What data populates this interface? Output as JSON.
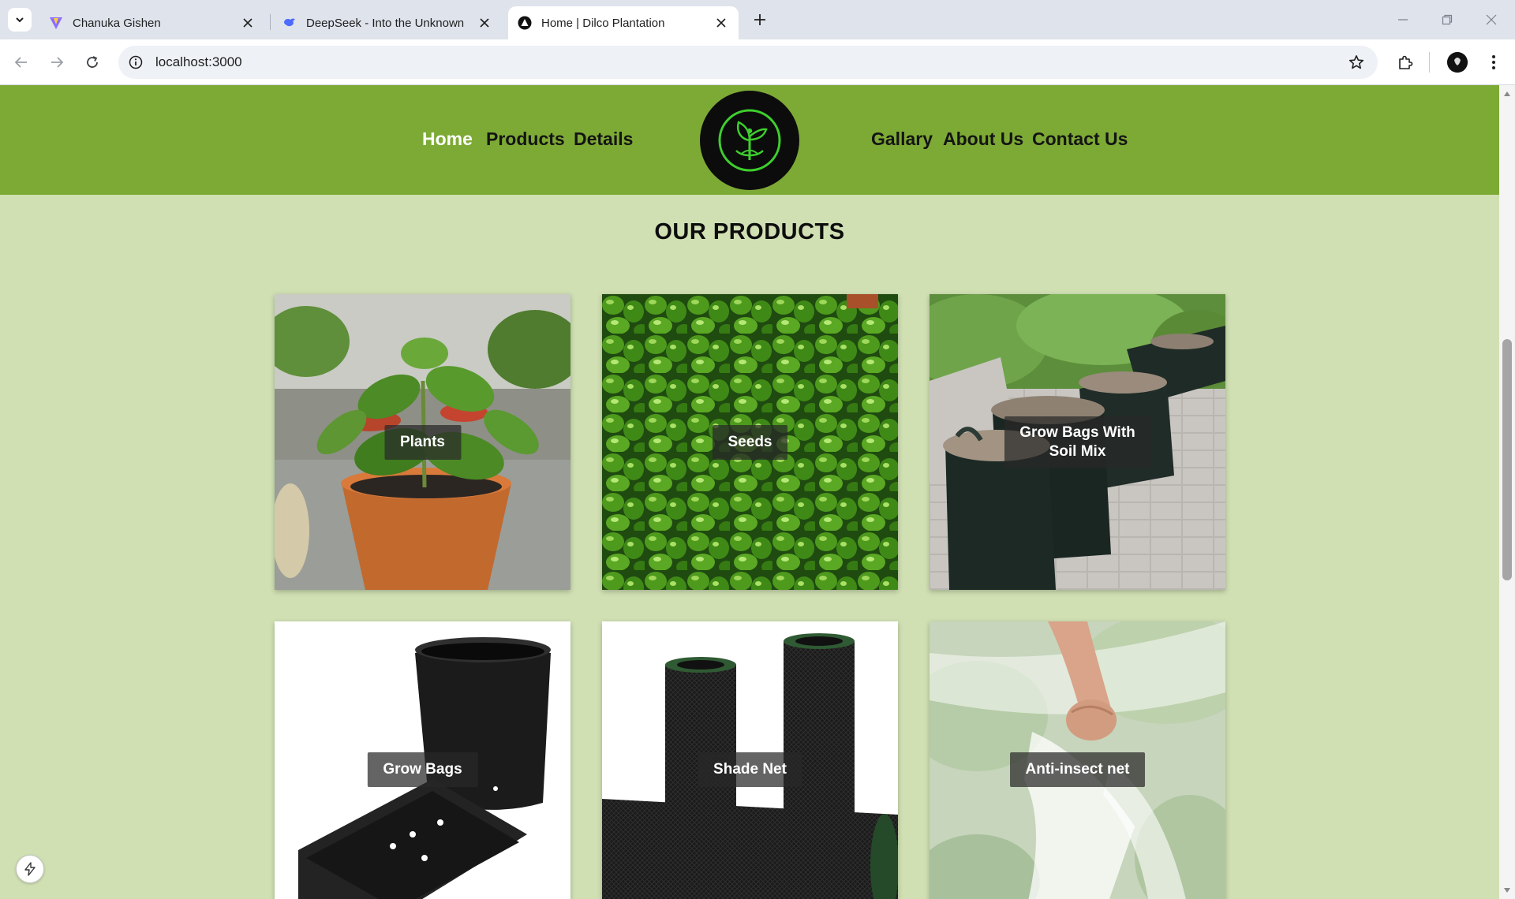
{
  "browser": {
    "tabs": [
      {
        "title": "Chanuka Gishen",
        "favicon": "vite-icon",
        "active": false
      },
      {
        "title": "DeepSeek - Into the Unknown",
        "favicon": "deepseek-icon",
        "active": false
      },
      {
        "title": "Home | Dilco Plantation",
        "favicon": "site-icon",
        "active": true
      }
    ],
    "address_bar": {
      "url": "localhost:3000"
    }
  },
  "site": {
    "nav_left": [
      "Home",
      "Products",
      "Details"
    ],
    "nav_right": [
      "Gallary",
      "About Us",
      "Contact Us"
    ],
    "active_nav": "Home",
    "colors": {
      "header": "#7daa35",
      "background": "#d0e0b3",
      "logo_ring": "#3ecf2e"
    }
  },
  "products_section": {
    "title": "OUR PRODUCTS",
    "items": [
      {
        "label": "Plants"
      },
      {
        "label": "Seeds"
      },
      {
        "label": "Grow Bags With Soil Mix"
      },
      {
        "label": "Grow Bags"
      },
      {
        "label": "Shade Net"
      },
      {
        "label": "Anti-insect net"
      }
    ]
  }
}
